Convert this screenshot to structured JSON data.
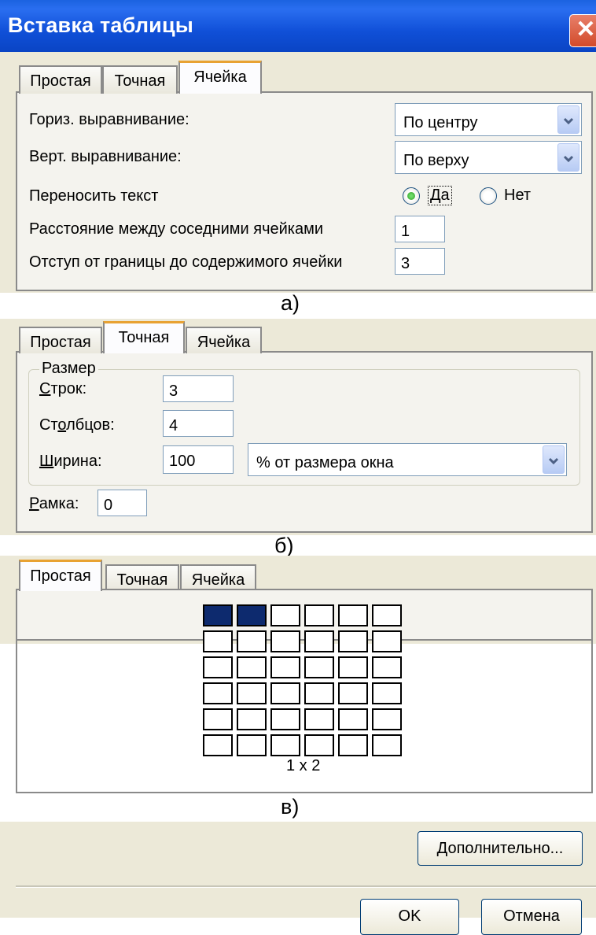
{
  "window": {
    "title": "Вставка таблицы",
    "close_glyph": "✕"
  },
  "tabs": {
    "simple": "Простая",
    "exact": "Точная",
    "cell": "Ячейка"
  },
  "cell_tab": {
    "horiz_align_label": "Гориз. выравнивание:",
    "horiz_align_value": "По центру",
    "vert_align_label": "Верт. выравнивание:",
    "vert_align_value": "По верху",
    "wrap_text_label": "Переносить текст",
    "wrap_yes": "Да",
    "wrap_no": "Нет",
    "cell_spacing_label": "Расстояние между соседними ячейками",
    "cell_spacing_value": "1",
    "cell_padding_label": "Отступ от границы до содержимого ячейки",
    "cell_padding_value": "3"
  },
  "captions": {
    "a": "а)",
    "b": "б)",
    "c": "в)"
  },
  "exact_tab": {
    "group_label": "Размер",
    "rows_label_first": "С",
    "rows_label_rest": "трок:",
    "rows_value": "3",
    "cols_label_pre": "Ст",
    "cols_label_u": "о",
    "cols_label_post": "лбцов:",
    "cols_value": "4",
    "width_label_first": "Ш",
    "width_label_rest": "ирина:",
    "width_value": "100",
    "width_unit": "% от размера окна",
    "border_label_first": "Р",
    "border_label_rest": "амка:",
    "border_value": "0"
  },
  "simple_tab": {
    "selection_readout": "1 x 2"
  },
  "buttons": {
    "advanced_first": "Д",
    "advanced_rest": "ополнительно...",
    "ok": "OK",
    "cancel": "Отмена"
  }
}
